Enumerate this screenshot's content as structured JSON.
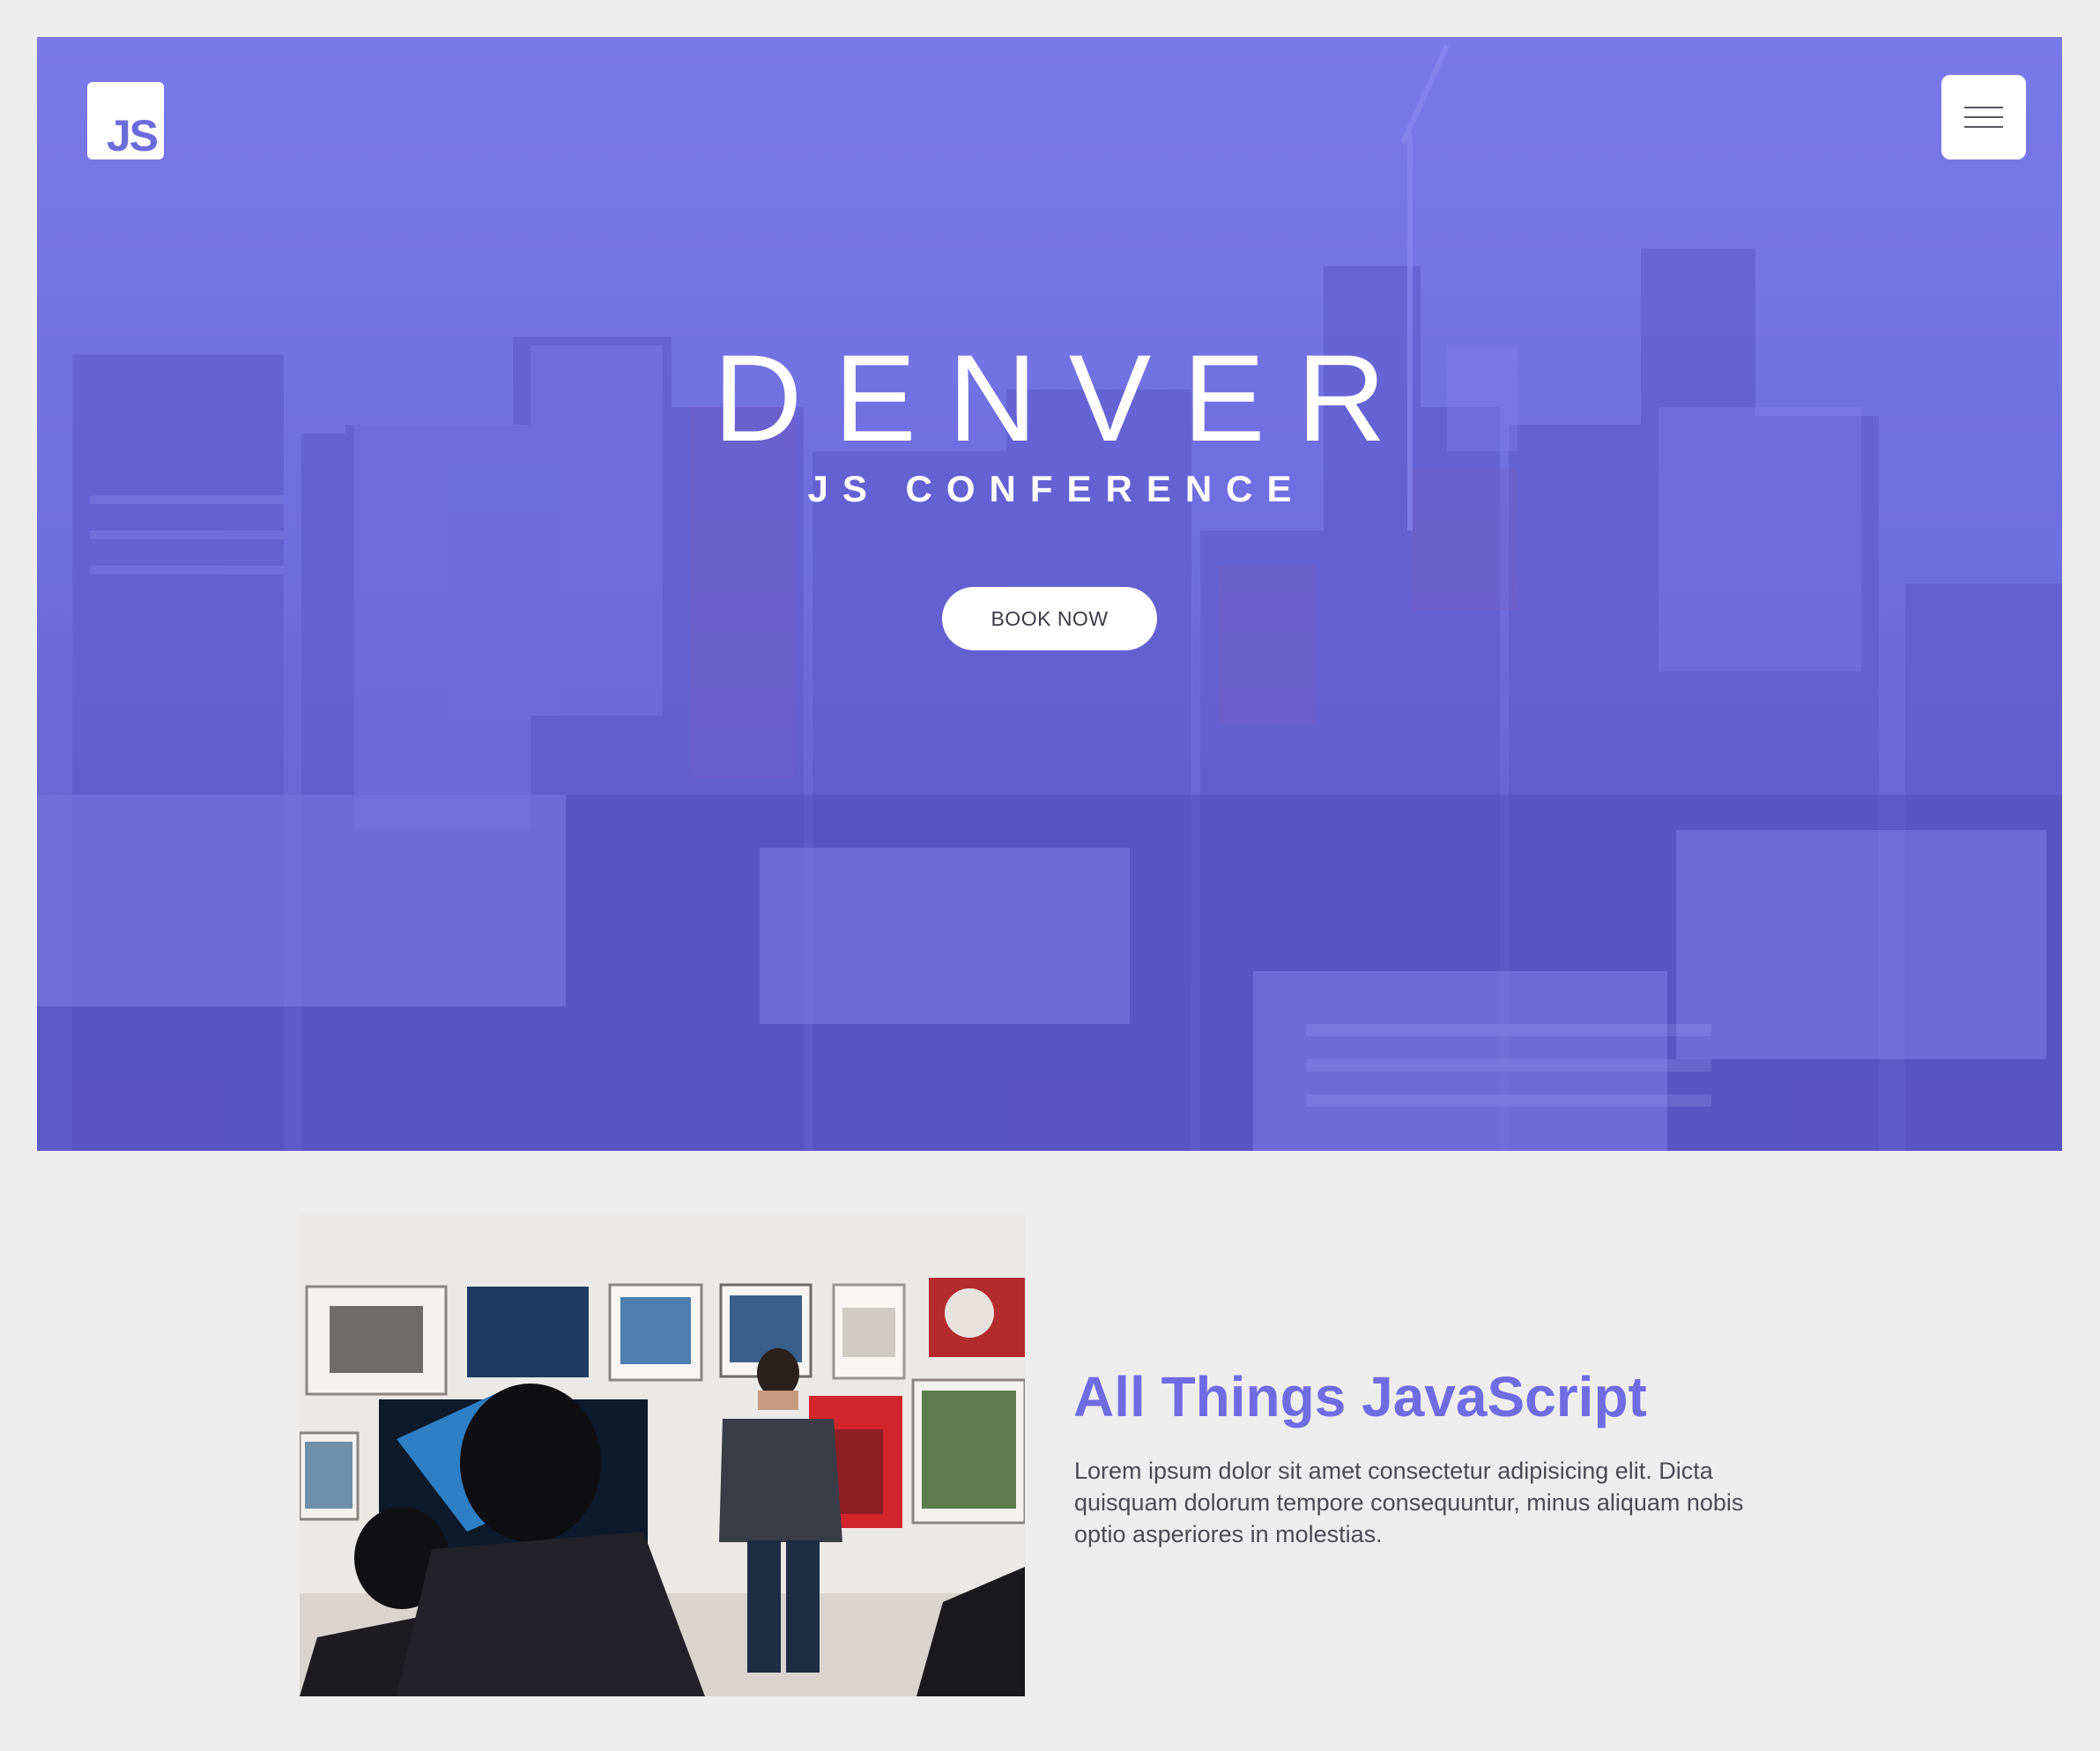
{
  "hero": {
    "logo_text": "JS",
    "title": "DENVER",
    "subtitle": "JS CONFERENCE",
    "cta_label": "BOOK NOW"
  },
  "feature": {
    "heading": "All Things JavaScript",
    "body": "Lorem ipsum dolor sit amet consectetur adipisicing elit. Dicta quisquam dolorum tempore consequuntur, minus aliquam nobis optio asperiores in molestias."
  },
  "icons": {
    "menu": "hamburger-menu-icon",
    "logo": "js-logo"
  },
  "colors": {
    "accent": "#6f6be3",
    "hero_overlay": "#7473e6",
    "page_background": "#eeedee",
    "button_background": "#ffffff",
    "body_text": "#4a4a52"
  }
}
